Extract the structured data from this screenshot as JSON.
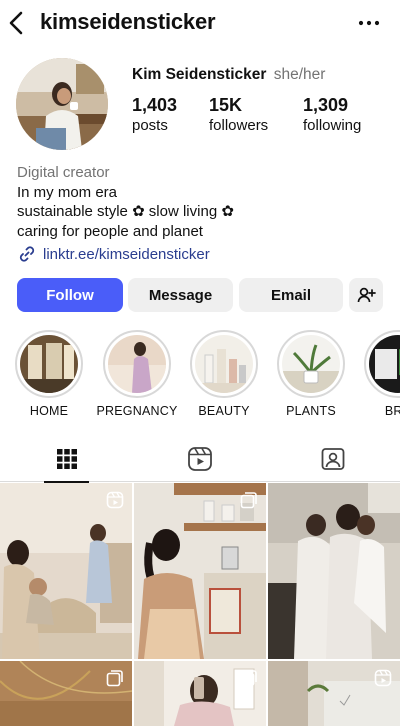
{
  "header": {
    "username": "kimseidensticker",
    "back_icon": "chevron-left-icon",
    "more_icon": "more-horizontal-icon"
  },
  "profile": {
    "display_name": "Kim Seidensticker",
    "pronouns": "she/her",
    "stats": [
      {
        "value": "1,403",
        "label": "posts"
      },
      {
        "value": "15K",
        "label": "followers"
      },
      {
        "value": "1,309",
        "label": "following"
      }
    ]
  },
  "bio": {
    "category": "Digital creator",
    "lines": [
      "In my mom era",
      "sustainable style ✿ slow living ✿",
      "caring for people and planet"
    ],
    "link": "linktr.ee/kimseidensticker"
  },
  "actions": {
    "follow": "Follow",
    "message": "Message",
    "email": "Email",
    "add_person_icon": "add-person-icon"
  },
  "highlights": [
    {
      "label": "HOME"
    },
    {
      "label": "PREGNANCY"
    },
    {
      "label": "BEAUTY"
    },
    {
      "label": "PLANTS"
    },
    {
      "label": "BRA"
    }
  ],
  "tabs": [
    {
      "name": "posts",
      "icon": "grid-icon",
      "active": true
    },
    {
      "name": "reels",
      "icon": "reels-icon",
      "active": false
    },
    {
      "name": "tagged",
      "icon": "tagged-icon",
      "active": false
    }
  ],
  "colors": {
    "follow_button": "#4a5df9",
    "link": "#2a3d8f",
    "secondary_text": "#737373"
  }
}
